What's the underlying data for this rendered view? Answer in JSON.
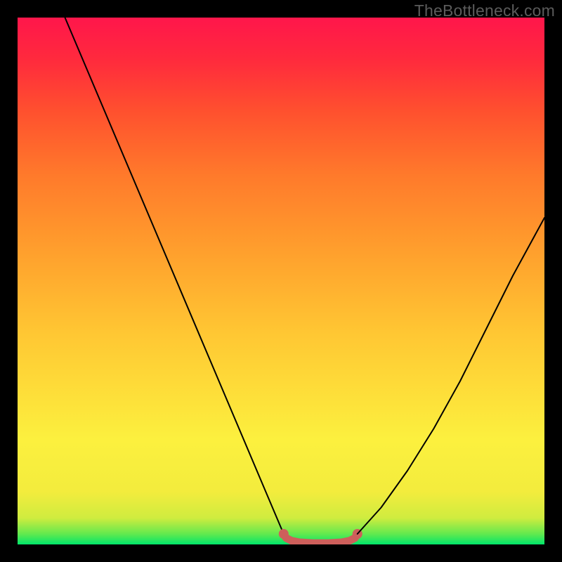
{
  "watermark": "TheBottleneck.com",
  "chart_data": {
    "type": "line",
    "title": "",
    "xlabel": "",
    "ylabel": "",
    "xlim": [
      0,
      100
    ],
    "ylim": [
      0,
      100
    ],
    "grid": false,
    "background_gradient_stops": [
      {
        "offset": 0,
        "color": "#00e56a"
      },
      {
        "offset": 2,
        "color": "#63e94e"
      },
      {
        "offset": 5,
        "color": "#cfec3f"
      },
      {
        "offset": 10,
        "color": "#f3ec3d"
      },
      {
        "offset": 20,
        "color": "#fcf03e"
      },
      {
        "offset": 40,
        "color": "#ffc733"
      },
      {
        "offset": 55,
        "color": "#ffa12d"
      },
      {
        "offset": 70,
        "color": "#ff7a2b"
      },
      {
        "offset": 82,
        "color": "#ff512e"
      },
      {
        "offset": 92,
        "color": "#ff2a3d"
      },
      {
        "offset": 100,
        "color": "#ff164b"
      }
    ],
    "series": [
      {
        "name": "left-slope",
        "style": "black-thin",
        "x": [
          9,
          50.5
        ],
        "y": [
          100,
          2
        ]
      },
      {
        "name": "floor-curve",
        "style": "coral-thick",
        "points": [
          {
            "x": 50.5,
            "y": 2.0
          },
          {
            "x": 51.0,
            "y": 1.2
          },
          {
            "x": 52.0,
            "y": 0.7
          },
          {
            "x": 53.5,
            "y": 0.4
          },
          {
            "x": 56.0,
            "y": 0.25
          },
          {
            "x": 59.0,
            "y": 0.25
          },
          {
            "x": 61.5,
            "y": 0.4
          },
          {
            "x": 63.0,
            "y": 0.7
          },
          {
            "x": 64.0,
            "y": 1.2
          },
          {
            "x": 64.5,
            "y": 2.0
          }
        ],
        "end_markers": [
          {
            "x": 50.5,
            "y": 2.0
          },
          {
            "x": 64.5,
            "y": 2.0
          }
        ]
      },
      {
        "name": "right-curve",
        "style": "black-thin",
        "points": [
          {
            "x": 64.5,
            "y": 2.0
          },
          {
            "x": 69.0,
            "y": 7.0
          },
          {
            "x": 74.0,
            "y": 14.0
          },
          {
            "x": 79.0,
            "y": 22.0
          },
          {
            "x": 84.0,
            "y": 31.0
          },
          {
            "x": 89.0,
            "y": 41.0
          },
          {
            "x": 94.0,
            "y": 51.0
          },
          {
            "x": 100.0,
            "y": 62.0
          }
        ]
      }
    ]
  }
}
